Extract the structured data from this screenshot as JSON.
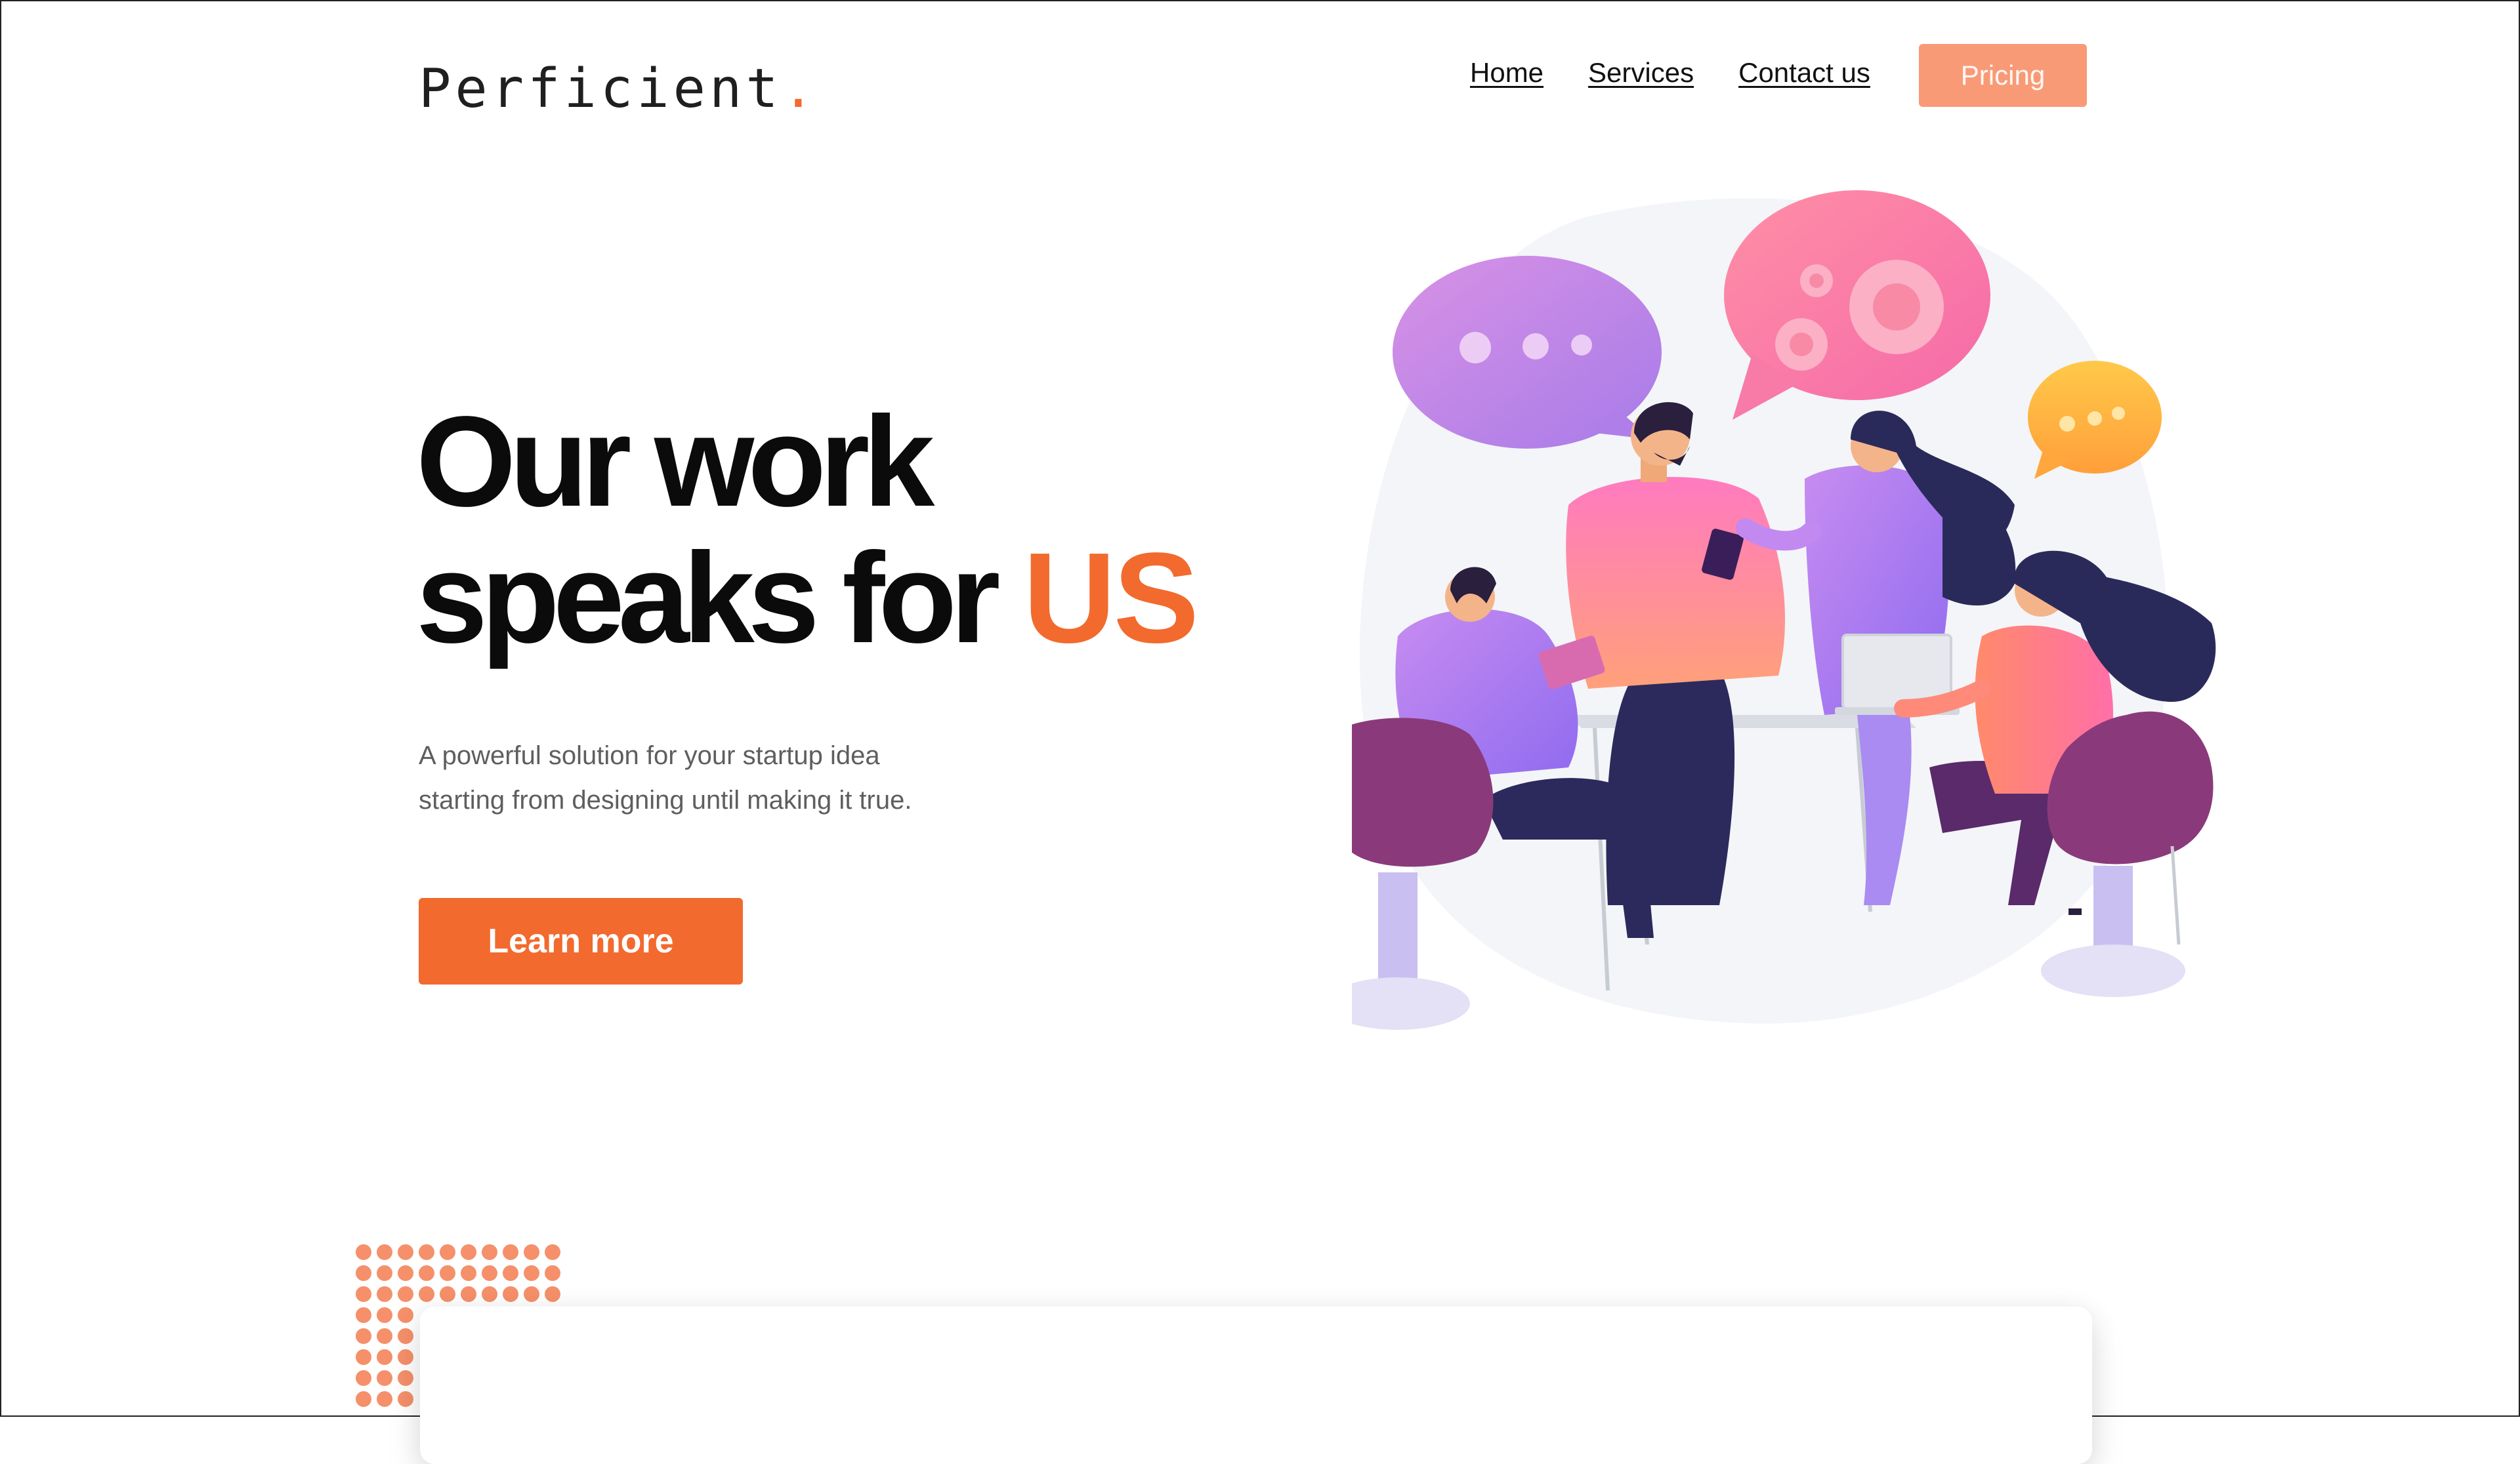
{
  "brand": {
    "name": "Perficient",
    "dot": ".",
    "accent_color": "#f26a2e"
  },
  "nav": {
    "links": [
      "Home",
      "Services",
      "Contact us"
    ],
    "pricing_label": "Pricing",
    "pricing_color": "#f99a77"
  },
  "hero": {
    "title_line1": "Our work",
    "title_line2_prefix": "speaks for ",
    "title_highlight": "US",
    "subtitle_line1": "A powerful solution for your startup idea",
    "subtitle_line2": "starting from designing until making it true.",
    "cta_label": "Learn more",
    "cta_color": "#f26a2e"
  },
  "illustration": {
    "icon": "team-meeting-illustration",
    "bubbles": [
      "speech-bubble-dots-icon",
      "speech-bubble-gears-icon",
      "speech-bubble-small-icon"
    ]
  }
}
